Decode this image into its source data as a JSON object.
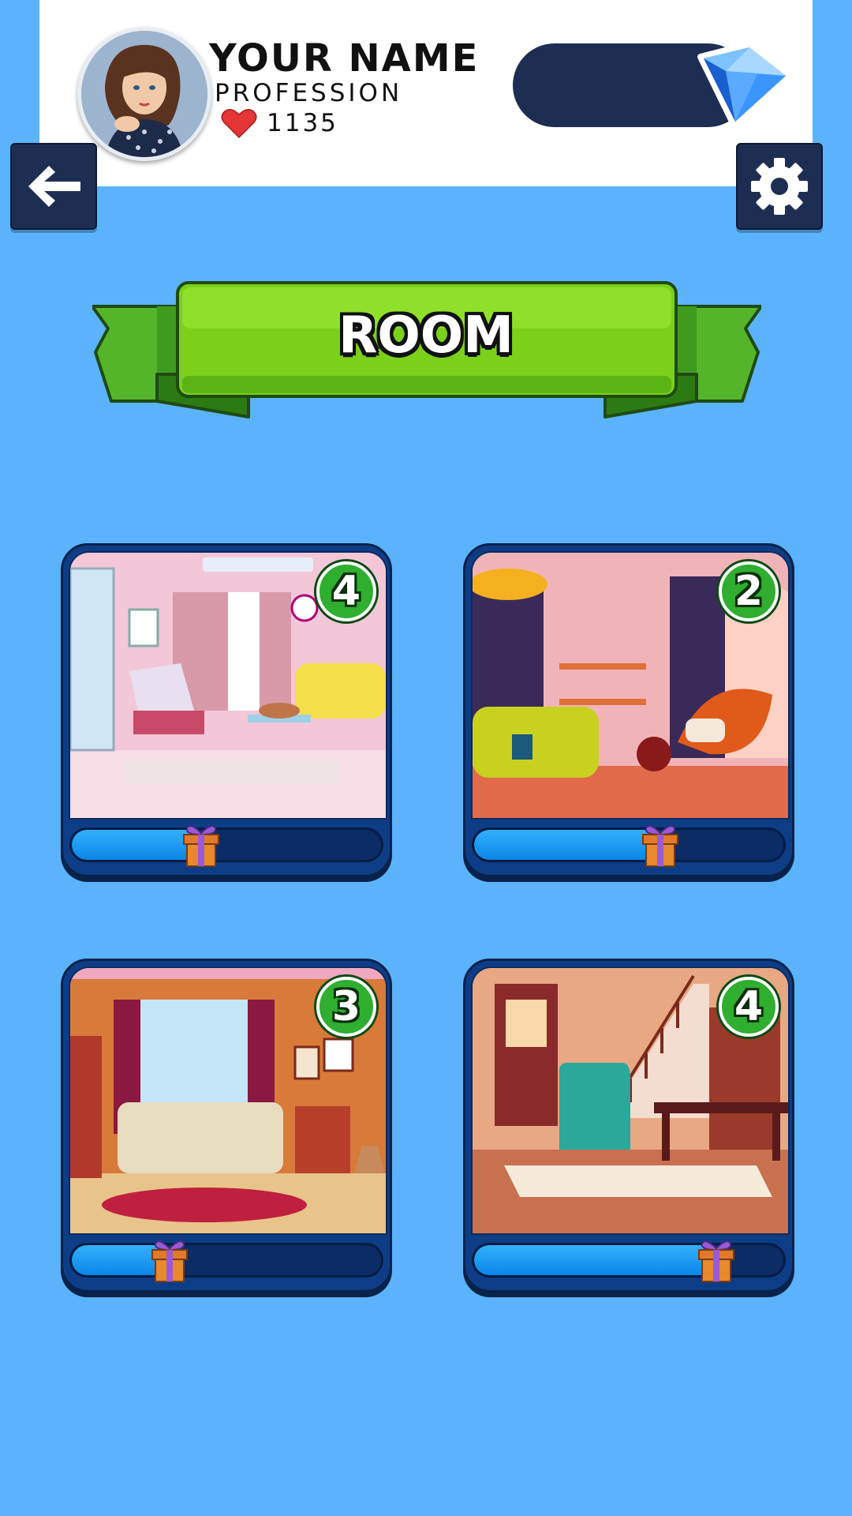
{
  "header": {
    "player_name": "YOUR NAME",
    "profession": "PROFESSION",
    "likes": "1135"
  },
  "nav": {
    "back_icon": "arrow-left-icon",
    "settings_icon": "gear-icon"
  },
  "banner": {
    "title": "ROOM"
  },
  "rooms": [
    {
      "level": "4",
      "progress": 0.42,
      "theme": "pink-living-room"
    },
    {
      "level": "2",
      "progress": 0.6,
      "theme": "pink-lounge-orange-chair"
    },
    {
      "level": "3",
      "progress": 0.32,
      "theme": "orange-living-room"
    },
    {
      "level": "4",
      "progress": 0.78,
      "theme": "staircase-hall"
    }
  ],
  "colors": {
    "background": "#5ab3fc",
    "navy": "#1e2e52",
    "ribbon_green": "#7bd01a",
    "badge_green": "#2fae2f",
    "card_blue": "#0d3d86",
    "progress_blue": "#1a9cf5"
  }
}
